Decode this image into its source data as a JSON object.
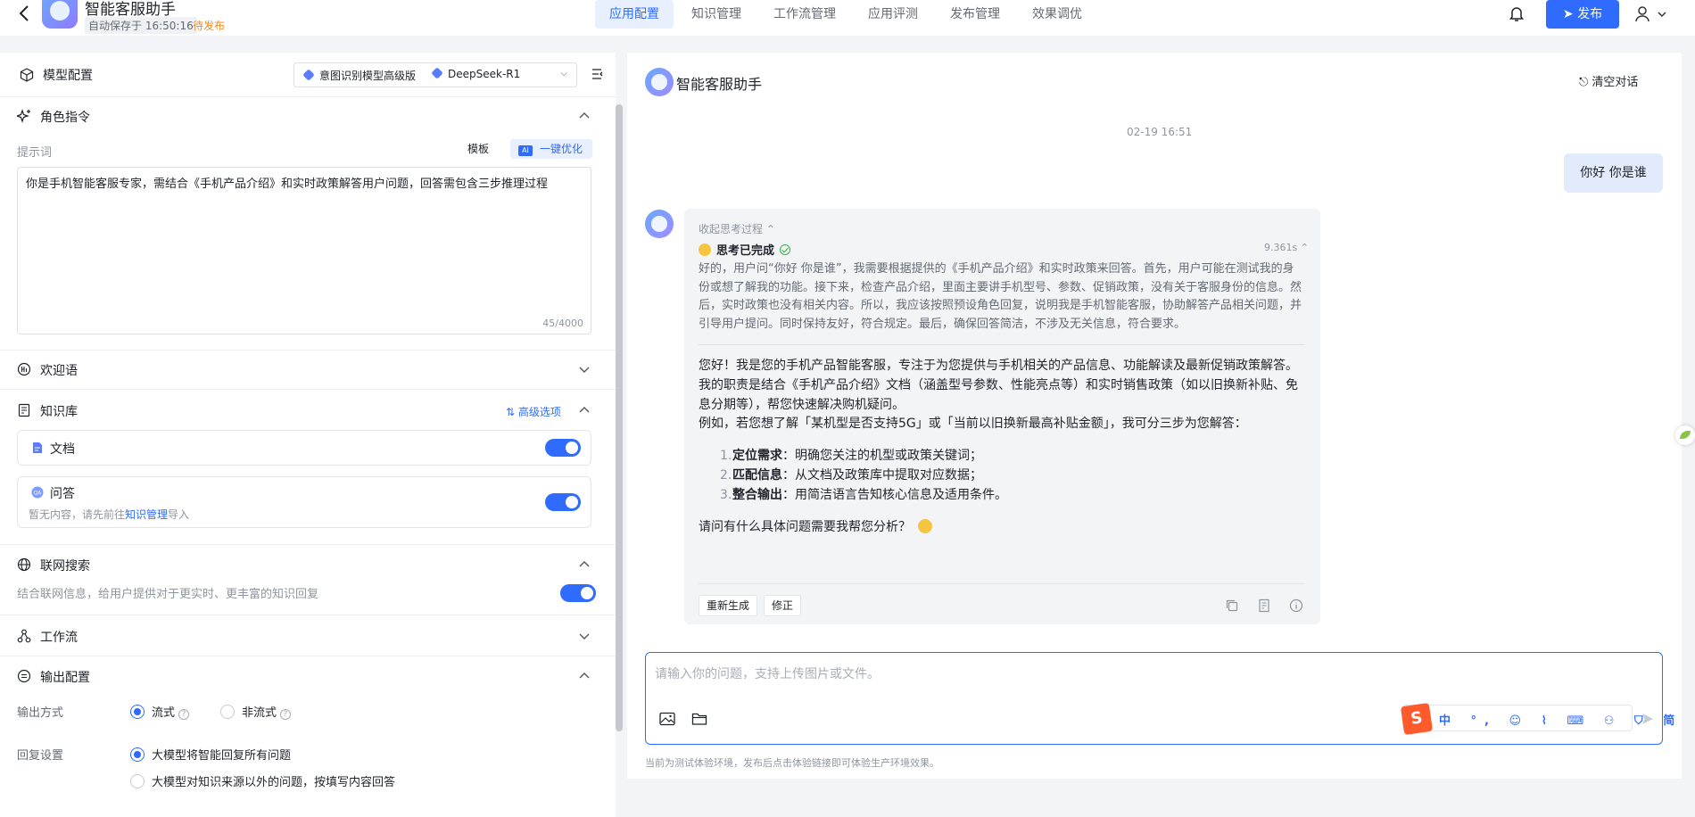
{
  "header": {
    "app_title": "智能客服助手",
    "autosave": "自动保存于 16:50:16",
    "status": "待发布",
    "tabs": [
      {
        "label": "应用配置",
        "active": true
      },
      {
        "label": "知识管理"
      },
      {
        "label": "工作流管理"
      },
      {
        "label": "应用评测"
      },
      {
        "label": "发布管理"
      },
      {
        "label": "效果调优"
      }
    ],
    "publish_label": "发布"
  },
  "left": {
    "model_config_title": "模型配置",
    "model_intent": "意图识别模型高级版",
    "model_main": "DeepSeek-R1",
    "role_title": "角色指令",
    "prompt_label": "提示词",
    "template_btn": "模板",
    "ai_badge": "AI",
    "optimize_btn": "一键优化",
    "prompt_text": "你是手机智能客服专家，需结合《手机产品介绍》和实时政策解答用户问题，回答需包含三步推理过程",
    "prompt_count": "45/4000",
    "welcome_title": "欢迎语",
    "kb_title": "知识库",
    "kb_adv": "高级选项",
    "kb_doc": {
      "label": "文档",
      "enabled": true
    },
    "kb_qa": {
      "label": "问答",
      "badge": "QA",
      "hint_prefix": "暂无内容，请先前往",
      "hint_link": "知识管理",
      "hint_suffix": "导入",
      "enabled": true
    },
    "web_title": "联网搜索",
    "web_desc": "结合联网信息，给用户提供对于更实时、更丰富的知识回复",
    "web_enabled": true,
    "workflow_title": "工作流",
    "output_title": "输出配置",
    "output_mode_label": "输出方式",
    "output_mode_options": [
      {
        "label": "流式",
        "selected": true
      },
      {
        "label": "非流式",
        "selected": false
      }
    ],
    "reply_label": "回复设置",
    "reply_options": [
      {
        "label": "大模型将智能回复所有问题",
        "selected": true
      },
      {
        "label": "大模型对知识来源以外的问题，按填写内容回答",
        "selected": false
      }
    ]
  },
  "chat": {
    "title": "智能客服助手",
    "clear_label": "清空对话",
    "timestamp": "02-19 16:51",
    "user_message": "你好 你是谁",
    "collapse_label": "收起思考过程 ⌃",
    "think_done": "思考已完成",
    "think_time": "9.361s ⌃",
    "think_text": "好的，用户问“你好 你是谁”，我需要根据提供的《手机产品介绍》和实时政策来回答。首先，用户可能在测试我的身份或想了解我的功能。接下来，检查产品介绍，里面主要讲手机型号、参数、促销政策，没有关于客服身份的信息。然后，实时政策也没有相关内容。所以，我应该按照预设角色回复，说明我是手机智能客服，协助解答产品相关问题，并引导用户提问。同时保持友好，符合规定。最后，确保回答简洁，不涉及无关信息，符合要求。",
    "answer_p1": "您好！我是您的手机产品智能客服，专注于为您提供与手机相关的产品信息、功能解读及最新促销政策解答。我的职责是结合《手机产品介绍》文档（涵盖型号参数、性能亮点等）和实时销售政策（如以旧换新补贴、免息分期等），帮您快速解决购机疑问。",
    "answer_p2": "例如，若您想了解「某机型是否支持5G」或「当前以旧换新最高补贴金额」，我可分三步为您解答：",
    "steps": [
      {
        "num": "1.",
        "bold": "定位需求",
        "text": "：明确您关注的机型或政策关键词；"
      },
      {
        "num": "2.",
        "bold": "匹配信息",
        "text": "：从文档及政策库中提取对应数据；"
      },
      {
        "num": "3.",
        "bold": "整合输出",
        "text": "：用简洁语言告知核心信息及适用条件。"
      }
    ],
    "answer_p3": "请问有什么具体问题需要我帮您分析？",
    "regen_label": "重新生成",
    "edit_label": "修正",
    "input_placeholder": "请输入你的问题，支持上传图片或文件。",
    "ime_logo": "S",
    "ime_items": "中 °, ☺ ⌇ ⌨ ⚇ ⛉ 简 ▦",
    "footer_note": "当前为测试体验环境，发布后点击体验链接即可体验生产环境效果。"
  },
  "colors": {
    "accent": "#2f6bff",
    "status_orange": "#f58a1f",
    "user_bubble": "#e1ebfb"
  }
}
